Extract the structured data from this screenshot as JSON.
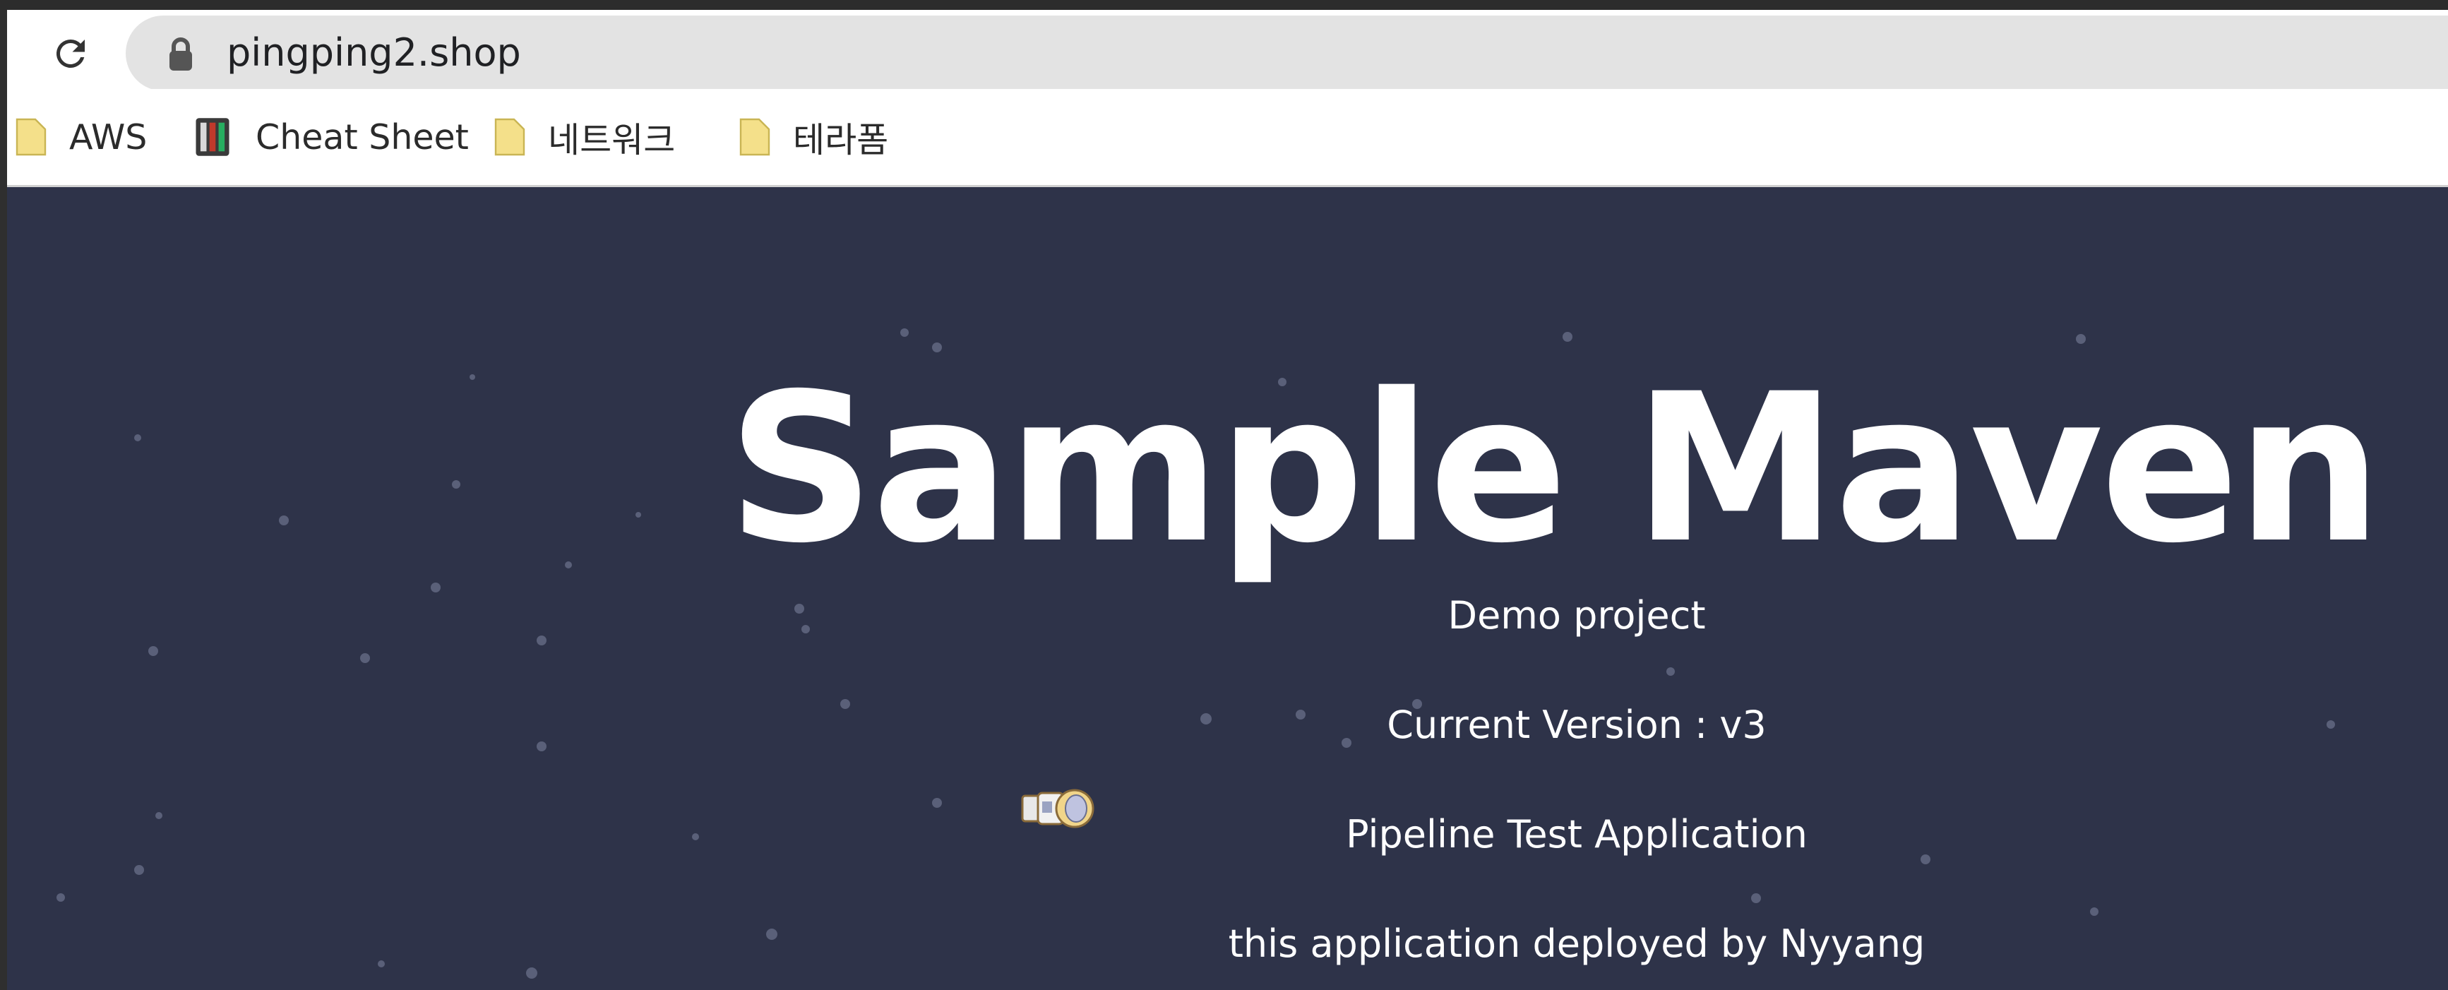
{
  "browser": {
    "url": "pingping2.shop",
    "reload_icon": "reload-icon",
    "lock_icon": "lock-icon"
  },
  "bookmarks": [
    {
      "label": "AWS",
      "icon": "folder-icon"
    },
    {
      "label": "Cheat Sheet",
      "icon": "cheat-sheet-icon"
    },
    {
      "label": "네트워크",
      "icon": "folder-icon"
    },
    {
      "label": "테라폼",
      "icon": "folder-icon"
    }
  ],
  "page": {
    "title": "Sample Maven Web",
    "lines": [
      "Demo project",
      "Current Version : v3",
      "Pipeline Test Application",
      "this application deployed by Nyyang"
    ],
    "background_color": "#2e3349",
    "text_color": "#ffffff",
    "decoration_icon": "astronaut-icon"
  }
}
